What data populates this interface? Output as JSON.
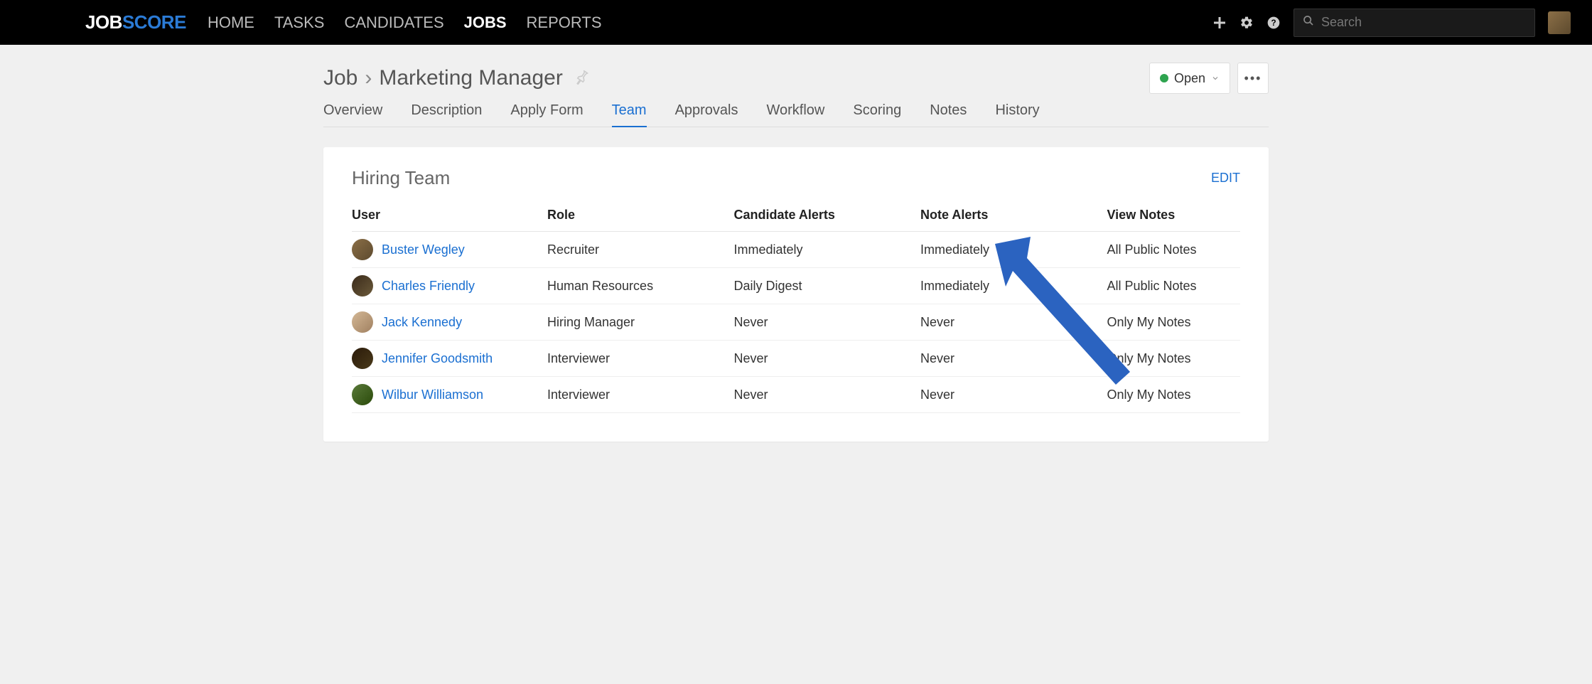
{
  "logo": {
    "part1": "JOB",
    "part2": "SCORE"
  },
  "nav": {
    "items": [
      {
        "label": "HOME",
        "active": false
      },
      {
        "label": "TASKS",
        "active": false
      },
      {
        "label": "CANDIDATES",
        "active": false
      },
      {
        "label": "JOBS",
        "active": true
      },
      {
        "label": "REPORTS",
        "active": false
      }
    ]
  },
  "search": {
    "placeholder": "Search"
  },
  "breadcrumb": {
    "root": "Job",
    "current": "Marketing Manager"
  },
  "status": {
    "label": "Open",
    "color": "#2ea44f"
  },
  "tabs": [
    {
      "label": "Overview",
      "active": false
    },
    {
      "label": "Description",
      "active": false
    },
    {
      "label": "Apply Form",
      "active": false
    },
    {
      "label": "Team",
      "active": true
    },
    {
      "label": "Approvals",
      "active": false
    },
    {
      "label": "Workflow",
      "active": false
    },
    {
      "label": "Scoring",
      "active": false
    },
    {
      "label": "Notes",
      "active": false
    },
    {
      "label": "History",
      "active": false
    }
  ],
  "card": {
    "title": "Hiring Team",
    "edit_label": "EDIT"
  },
  "table": {
    "headers": [
      "User",
      "Role",
      "Candidate Alerts",
      "Note Alerts",
      "View Notes"
    ],
    "rows": [
      {
        "user": "Buster Wegley",
        "role": "Recruiter",
        "candidate_alerts": "Immediately",
        "note_alerts": "Immediately",
        "view_notes": "All Public Notes"
      },
      {
        "user": "Charles Friendly",
        "role": "Human Resources",
        "candidate_alerts": "Daily Digest",
        "note_alerts": "Immediately",
        "view_notes": "All Public Notes"
      },
      {
        "user": "Jack Kennedy",
        "role": "Hiring Manager",
        "candidate_alerts": "Never",
        "note_alerts": "Never",
        "view_notes": "Only My Notes"
      },
      {
        "user": "Jennifer Goodsmith",
        "role": "Interviewer",
        "candidate_alerts": "Never",
        "note_alerts": "Never",
        "view_notes": "Only My Notes"
      },
      {
        "user": "Wilbur Williamson",
        "role": "Interviewer",
        "candidate_alerts": "Never",
        "note_alerts": "Never",
        "view_notes": "Only My Notes"
      }
    ]
  },
  "annotation": {
    "arrow_color": "#2B63C0"
  }
}
